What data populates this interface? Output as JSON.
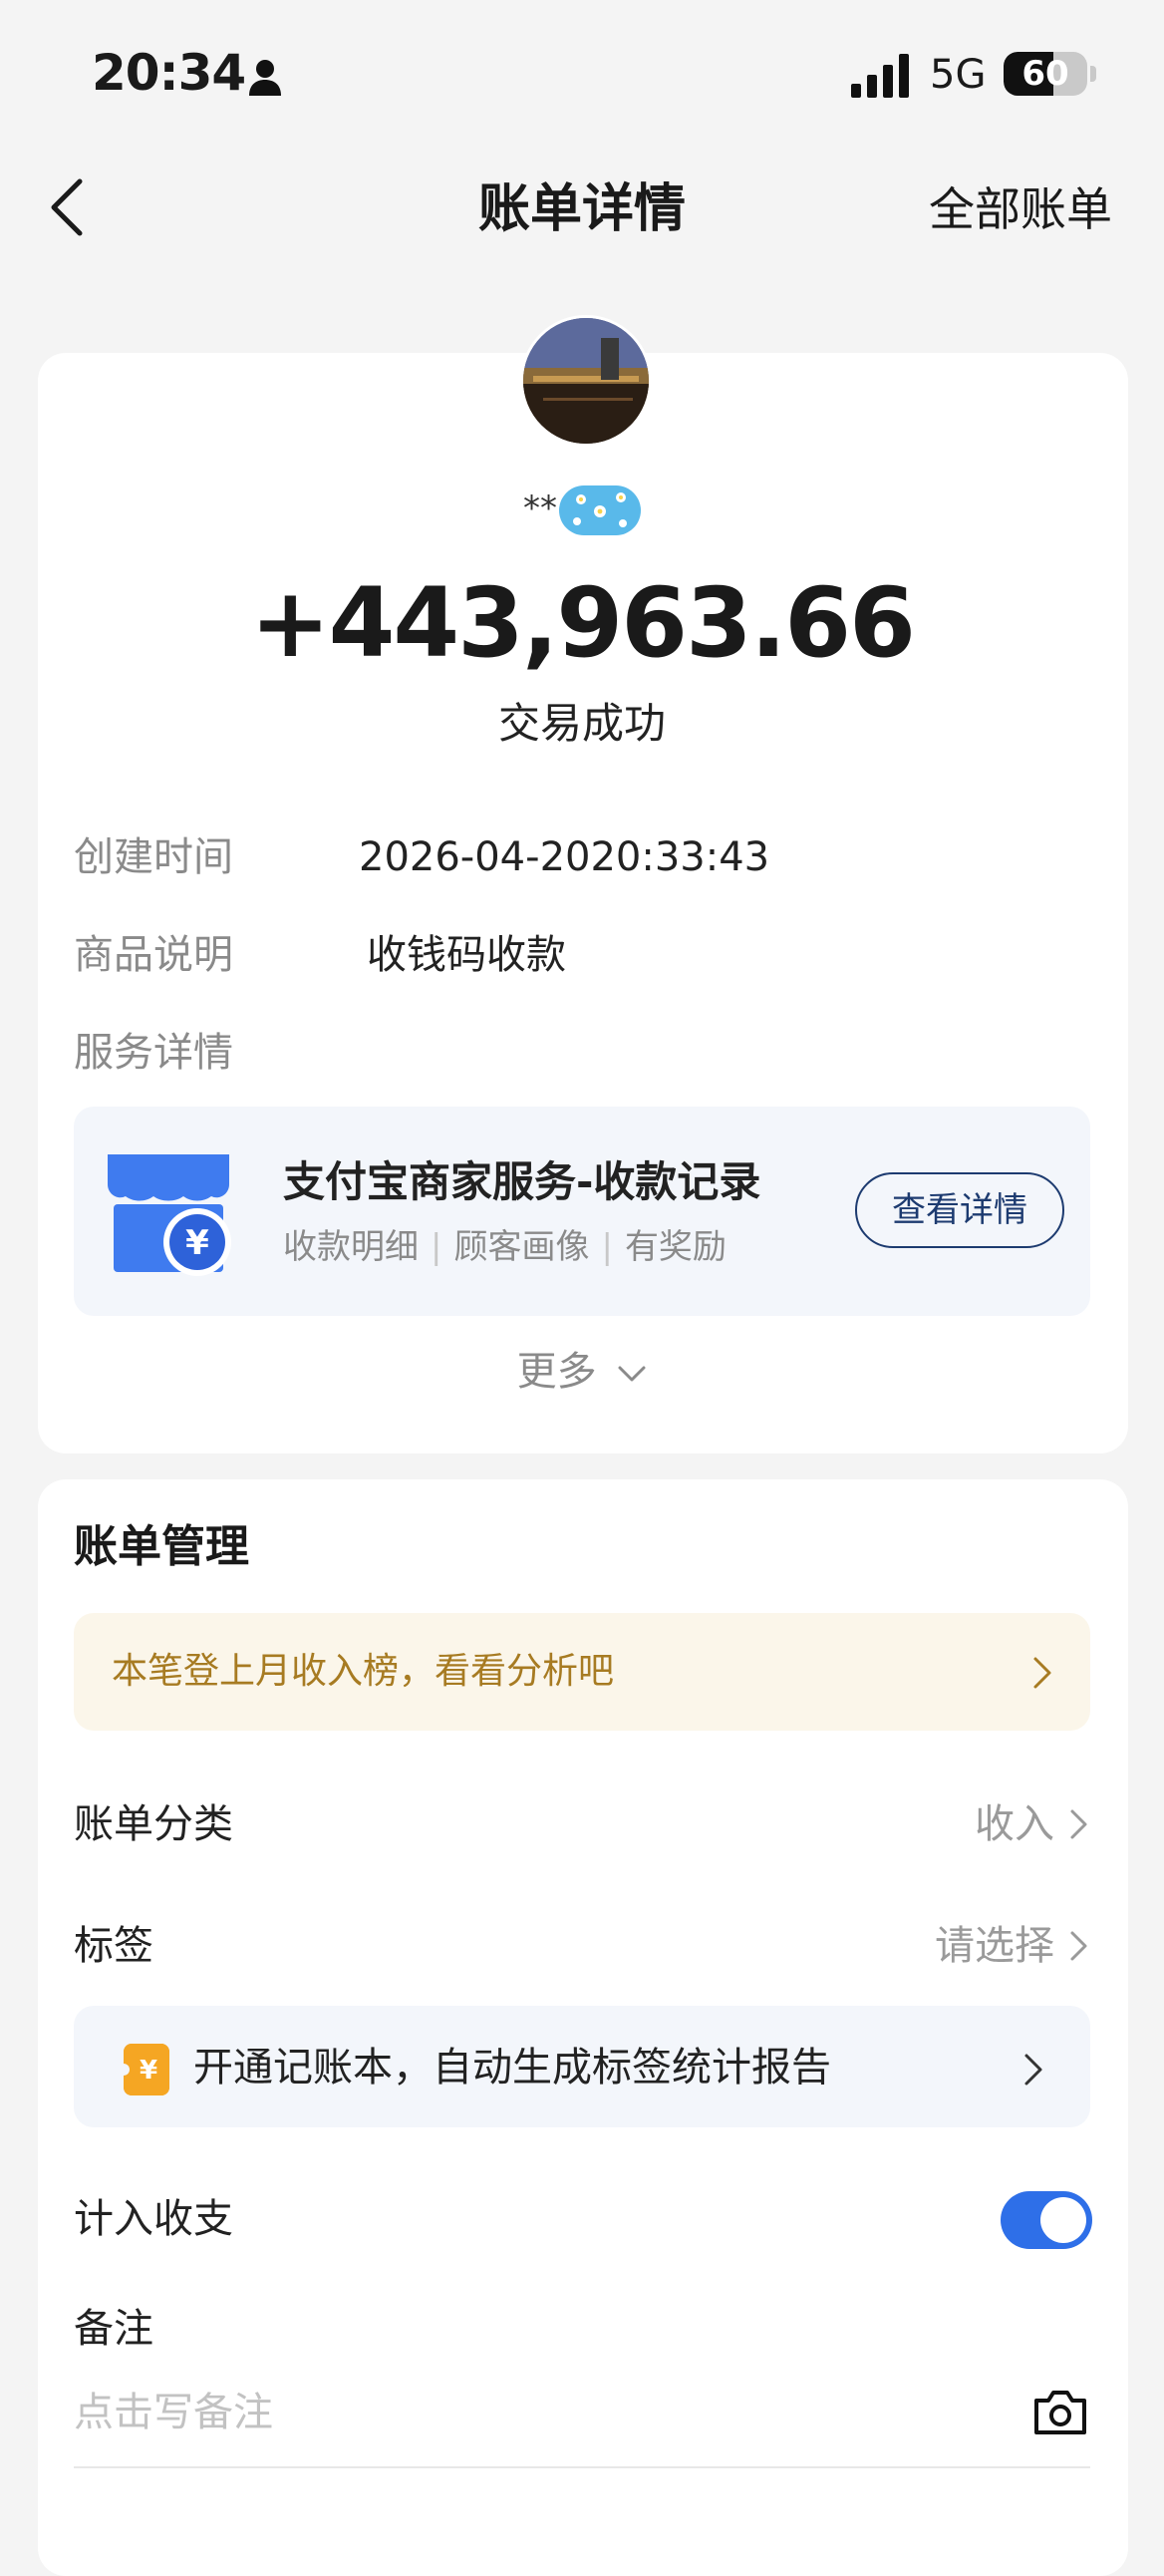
{
  "status_bar": {
    "time": "20:34",
    "network": "5G",
    "battery": "60",
    "battery_level": 0.6
  },
  "nav": {
    "title": "账单详情",
    "right_link": "全部账单",
    "back_icon": "chevron-left-icon"
  },
  "summary": {
    "name_masked": "**",
    "amount": "+443,963.66",
    "status": "交易成功"
  },
  "details": {
    "created_label": "创建时间",
    "created_value": "2026-04-2020:33:43",
    "product_label": "商品说明",
    "product_value": "收钱码收款",
    "service_label": "服务详情"
  },
  "service_card": {
    "title": "支付宝商家服务-收款记录",
    "subs": [
      "收款明细",
      "顾客画像",
      "有奖励"
    ],
    "button": "查看详情",
    "icon": "store-yuan-icon",
    "icon_color": "#3f7bef"
  },
  "more": {
    "label": "更多"
  },
  "management": {
    "title": "账单管理",
    "notice": "本笔登上月收入榜，看看分析吧",
    "category_label": "账单分类",
    "category_value": "收入",
    "tag_label": "标签",
    "tag_value": "请选择",
    "promo": "开通记账本，自动生成标签统计报告",
    "include_label": "计入收支",
    "include_on": true,
    "memo_label": "备注",
    "memo_placeholder": "点击写备注"
  },
  "colors": {
    "accent": "#2e6fe8",
    "notice_text": "#a77b22",
    "notice_bg": "#fbf6ea",
    "button_border": "#1d3b70",
    "promo_icon": "#f5a623"
  }
}
